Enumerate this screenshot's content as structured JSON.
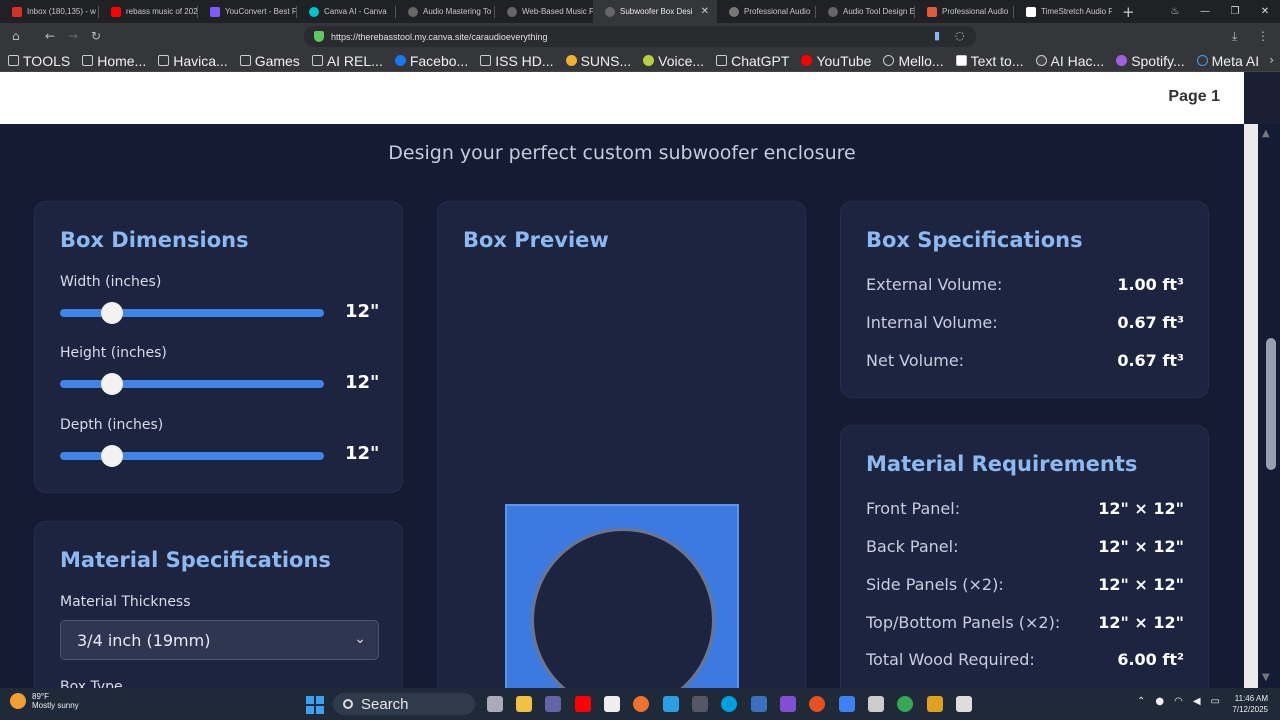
{
  "browser": {
    "tabs": [
      {
        "label": "Inbox (180,135) - w",
        "color": "#d93025"
      },
      {
        "label": "rebass music of 202",
        "color": "#ff0000"
      },
      {
        "label": "YouConvert - Best F",
        "color": "#7b5cff"
      },
      {
        "label": "Canva AI - Canva",
        "color": "#00c4cc"
      },
      {
        "label": "Audio Mastering To",
        "color": "#8a8a8a"
      },
      {
        "label": "Web-Based Music F",
        "color": "#8a8a8a"
      },
      {
        "label": "Subwoofer Box Desi",
        "color": "#8a8a8a",
        "active": true
      },
      {
        "label": "Professional Audio",
        "color": "#8a8a8a"
      },
      {
        "label": "Audio Tool Design E",
        "color": "#8a8a8a"
      },
      {
        "label": "Professional Audio",
        "color": "#e05a3a"
      },
      {
        "label": "TimeStretch Audio F",
        "color": "#ffffff"
      }
    ],
    "url": "https://therebasstool.my.canva.site/caraudioeverything",
    "bookmarks": [
      "TOOLS",
      "Home...",
      "Havica...",
      "Games",
      "AI REL...",
      "Facebo...",
      "ISS HD...",
      "SUNS...",
      "Voice...",
      "ChatGPT",
      "YouTube",
      "Mello...",
      "Text to...",
      "AI Hac...",
      "Spotify...",
      "Meta AI"
    ]
  },
  "page": {
    "page_label": "Page 1",
    "subtitle": "Design your perfect custom subwoofer enclosure"
  },
  "box_dimensions": {
    "title": "Box Dimensions",
    "sliders": [
      {
        "label": "Width (inches)",
        "value": "12\"",
        "fraction": 0.17
      },
      {
        "label": "Height (inches)",
        "value": "12\"",
        "fraction": 0.17
      },
      {
        "label": "Depth (inches)",
        "value": "12\"",
        "fraction": 0.17
      }
    ]
  },
  "material_specs": {
    "title": "Material Specifications",
    "thickness_label": "Material Thickness",
    "thickness_value": "3/4 inch (19mm)",
    "box_type_label": "Box Type"
  },
  "box_preview": {
    "title": "Box Preview"
  },
  "box_specs": {
    "title": "Box Specifications",
    "rows": [
      {
        "key": "External Volume:",
        "value": "1.00 ft³"
      },
      {
        "key": "Internal Volume:",
        "value": "0.67 ft³"
      },
      {
        "key": "Net Volume:",
        "value": "0.67 ft³"
      }
    ]
  },
  "material_req": {
    "title": "Material Requirements",
    "rows": [
      {
        "key": "Front Panel:",
        "value": "12\" × 12\""
      },
      {
        "key": "Back Panel:",
        "value": "12\" × 12\""
      },
      {
        "key": "Side Panels (×2):",
        "value": "12\" × 12\""
      },
      {
        "key": "Top/Bottom Panels (×2):",
        "value": "12\" × 12\""
      },
      {
        "key": "Total Wood Required:",
        "value": "6.00 ft²"
      }
    ]
  },
  "taskbar": {
    "weather_temp": "89°F",
    "weather_desc": "Mostly sunny",
    "search_label": "Search",
    "time": "11:46 AM",
    "date": "7/12/2025"
  }
}
